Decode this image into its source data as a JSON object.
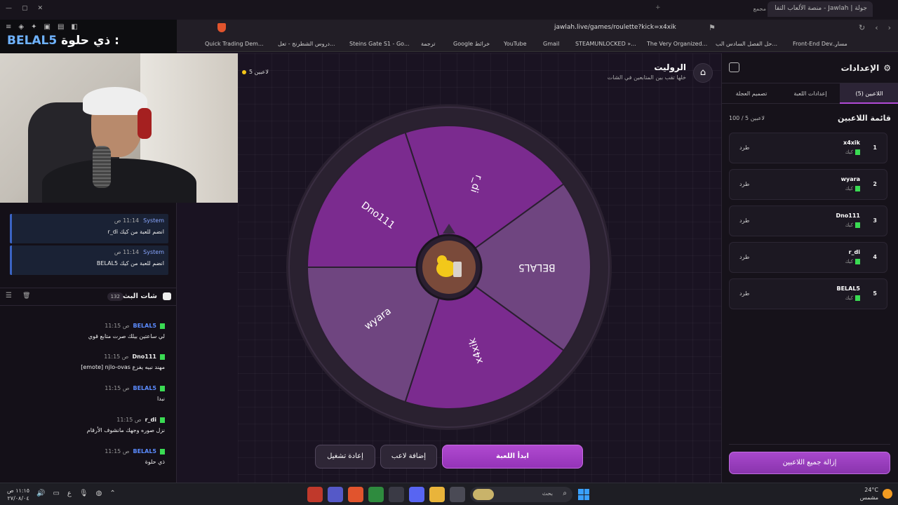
{
  "browser": {
    "active_tab": "جولة | Jawlah - منصة الألعاب التفا",
    "other_tab": "مجمع",
    "url": "jawlah.live/games/roulette?kick=x4xik",
    "bookmarks": [
      "Quick Trading Dem...",
      "دروس الشطرنج - تعل...",
      "Steins Gate S1 - Go...",
      "ترجمة",
      "Google خرائط",
      "YouTube",
      "Gmail",
      "STEAMUNLOCKED »...",
      "The Very Organized...",
      "حل الفصل السادس الب...",
      "Front-End Dev...",
      "مسار"
    ]
  },
  "overlay": {
    "caption_prefix": "ذي حلوة :",
    "caption_name": "BELAL5"
  },
  "chat": {
    "system_messages": [
      {
        "author": "System",
        "time": "11:14 ص",
        "text": "r_di انضم للعبة من كيك"
      },
      {
        "author": "System",
        "time": "11:14 ص",
        "text": "BELAL5 انضم للعبة من كيك"
      }
    ],
    "title": "شات البث",
    "count": "132",
    "messages": [
      {
        "author": "BELAL5",
        "time": "11:15 ص",
        "text": "لي ساعتين بيلك صرت متابع قوي",
        "color": "blue"
      },
      {
        "author": "Dno111",
        "time": "11:15 ص",
        "text": "[emote] njlo-ovas مهند نبيه يفزع",
        "color": "white"
      },
      {
        "author": "BELAL5",
        "time": "11:15 ص",
        "text": "نبدا",
        "color": "blue"
      },
      {
        "author": "r_di",
        "time": "11:15 ص",
        "text": "نزل صوره وجهك مانشوف الأرقام",
        "color": "white"
      },
      {
        "author": "BELAL5",
        "time": "11:15 ص",
        "text": "ذي حلوة",
        "color": "blue"
      }
    ]
  },
  "game": {
    "title": "الروليت",
    "subtitle": "خلها تقب بين المتابعين في الشات",
    "players_count": "5 لاعبين",
    "wheel_segments": [
      "r_di",
      "BELAL5",
      "x4xik",
      "wyara",
      "Dno111"
    ],
    "colors": {
      "seg_light": "#6f4580",
      "seg_dark": "#7b2b8f",
      "ring": "#2a2130",
      "accent": "#b04ad0"
    },
    "buttons": {
      "start": "ابدأ اللعبة",
      "add_player": "إضافة لاعب",
      "restart": "إعادة تشغيل"
    }
  },
  "settings": {
    "title": "الإعدادات",
    "tabs": [
      "اللاعبين (5)",
      "إعدادات اللعبة",
      "تصميم العجلة"
    ],
    "list_title": "قائمة اللاعبين",
    "list_count": "100 / 5 لاعبين",
    "players": [
      {
        "num": "1",
        "name": "x4xik",
        "platform": "كيك",
        "kick": "طرد"
      },
      {
        "num": "2",
        "name": "wyara",
        "platform": "كيك",
        "kick": "طرد"
      },
      {
        "num": "3",
        "name": "Dno111",
        "platform": "كيك",
        "kick": "طرد"
      },
      {
        "num": "4",
        "name": "r_di",
        "platform": "كيك",
        "kick": "طرد"
      },
      {
        "num": "5",
        "name": "BELAL5",
        "platform": "كيك",
        "kick": "طرد"
      }
    ],
    "remove_all": "إزالة جميع اللاعبين"
  },
  "taskbar": {
    "time": "١١:١٥ ص",
    "date": "٢٧/٠٨/٠٤",
    "search": "بحث",
    "weather_temp": "24°C",
    "weather_desc": "مشمس"
  }
}
